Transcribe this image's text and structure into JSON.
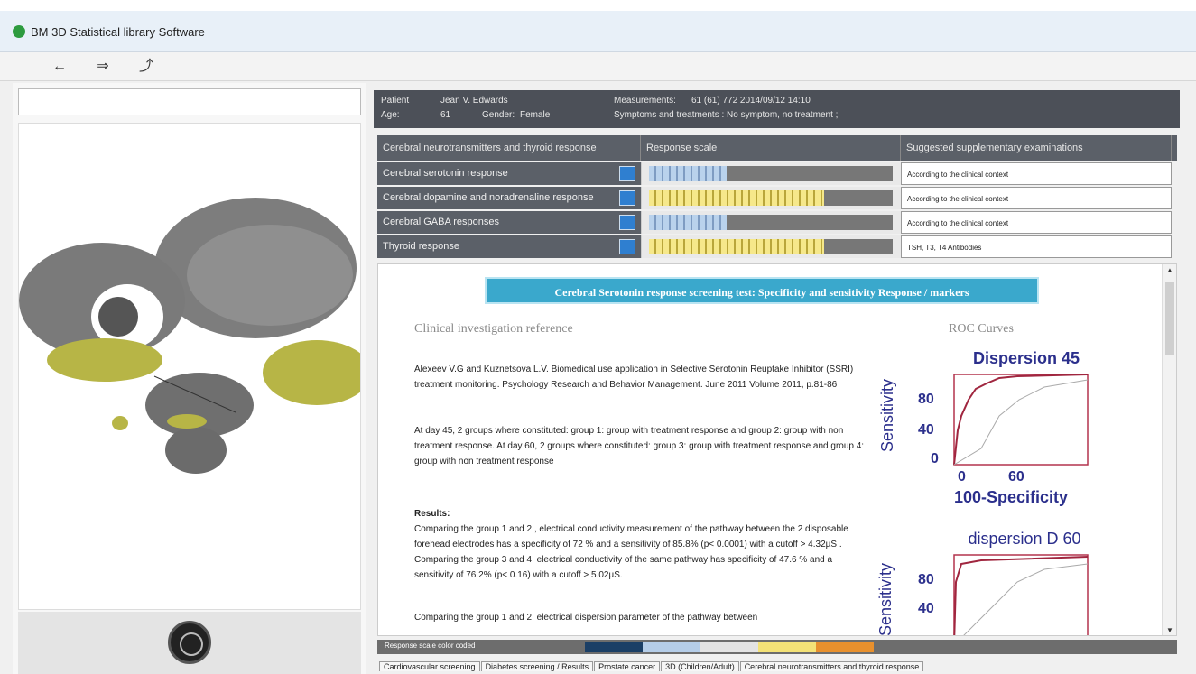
{
  "window": {
    "title": "BM 3D Statistical library Software"
  },
  "toolbar": {
    "back_icon": "left-arrow-icon",
    "forward_icon": "right-arrow-icon",
    "export_icon": "export-icon"
  },
  "patient": {
    "label_patient": "Patient",
    "name": "Jean V. Edwards",
    "label_age": "Age:",
    "age": "61",
    "label_gender": "Gender:",
    "gender": "Female",
    "label_meas": "Measurements:",
    "meas": "61 (61) 772 2014/09/12 14:10",
    "symptoms": "Symptoms and treatments : No symptom, no treatment ;"
  },
  "table": {
    "headers": [
      "Cerebral neurotransmitters and thyroid response",
      "Response scale",
      "Suggested supplementary examinations"
    ],
    "rows": [
      {
        "label": "Cerebral serotonin response",
        "fill": 0.32,
        "color": "blue",
        "suggestion": "According to the clinical context"
      },
      {
        "label": "Cerebral dopamine and noradrenaline response",
        "fill": 0.72,
        "color": "yellow",
        "suggestion": "According to the clinical context"
      },
      {
        "label": "Cerebral GABA responses",
        "fill": 0.32,
        "color": "blue",
        "suggestion": "According to the clinical context"
      },
      {
        "label": "Thyroid response",
        "fill": 0.72,
        "color": "yellow",
        "suggestion": "TSH, T3, T4 Antibodies"
      }
    ]
  },
  "content": {
    "banner": "Cerebral Serotonin response screening test: Specificity and sensitivity Response / markers",
    "h_clinical": "Clinical investigation reference",
    "h_roc": "ROC Curves",
    "ref": "Alexeev V.G and Kuznetsova L.V. Biomedical use application in Selective Serotonin Reuptake Inhibitor (SSRI) treatment monitoring. Psychology Research and Behavior Management. June 2011 Volume 2011, p.81-86",
    "p1": "At day 45, 2 groups where constituted: group 1: group with treatment response and group 2: group with non treatment response. At day 60, 2 groups where constituted: group 3: group with treatment response and group 4: group with non treatment response",
    "results_h": "Results:",
    "p2": "Comparing the group 1 and 2 , electrical conductivity measurement of the pathway between the 2 disposable forehead electrodes has a specificity of 72 % and a sensitivity of 85.8% (p< 0.0001) with a cutoff > 4.32µS . Comparing the group 3 and 4, electrical conductivity of the same pathway has specificity of 47.6 % and a sensitivity of 76.2% (p< 0.16) with a cutoff > 5.02µS.",
    "p3": "Comparing the group 1 and 2, electrical dispersion parameter of the pathway between"
  },
  "roc1": {
    "title": "Dispersion  45",
    "ylabel": "Sensitivity",
    "xlabel": "100-Specificity",
    "yticks": [
      "80",
      "40",
      "0"
    ],
    "xticks": [
      "0",
      "60"
    ]
  },
  "roc2": {
    "title": "dispersion D 60",
    "ylabel": "Sensitivity",
    "yticks": [
      "80",
      "40"
    ]
  },
  "legend": {
    "label": "Response scale color coded",
    "colors": [
      "#1b3f66",
      "#b5cde8",
      "#e3e3e3",
      "#f4e277",
      "#e8902d"
    ]
  },
  "tabs": [
    "Cardiovascular screening",
    "Diabetes screening / Results",
    "Prostate cancer",
    "3D (Children/Adult)",
    "Cerebral neurotransmitters and thyroid response"
  ]
}
